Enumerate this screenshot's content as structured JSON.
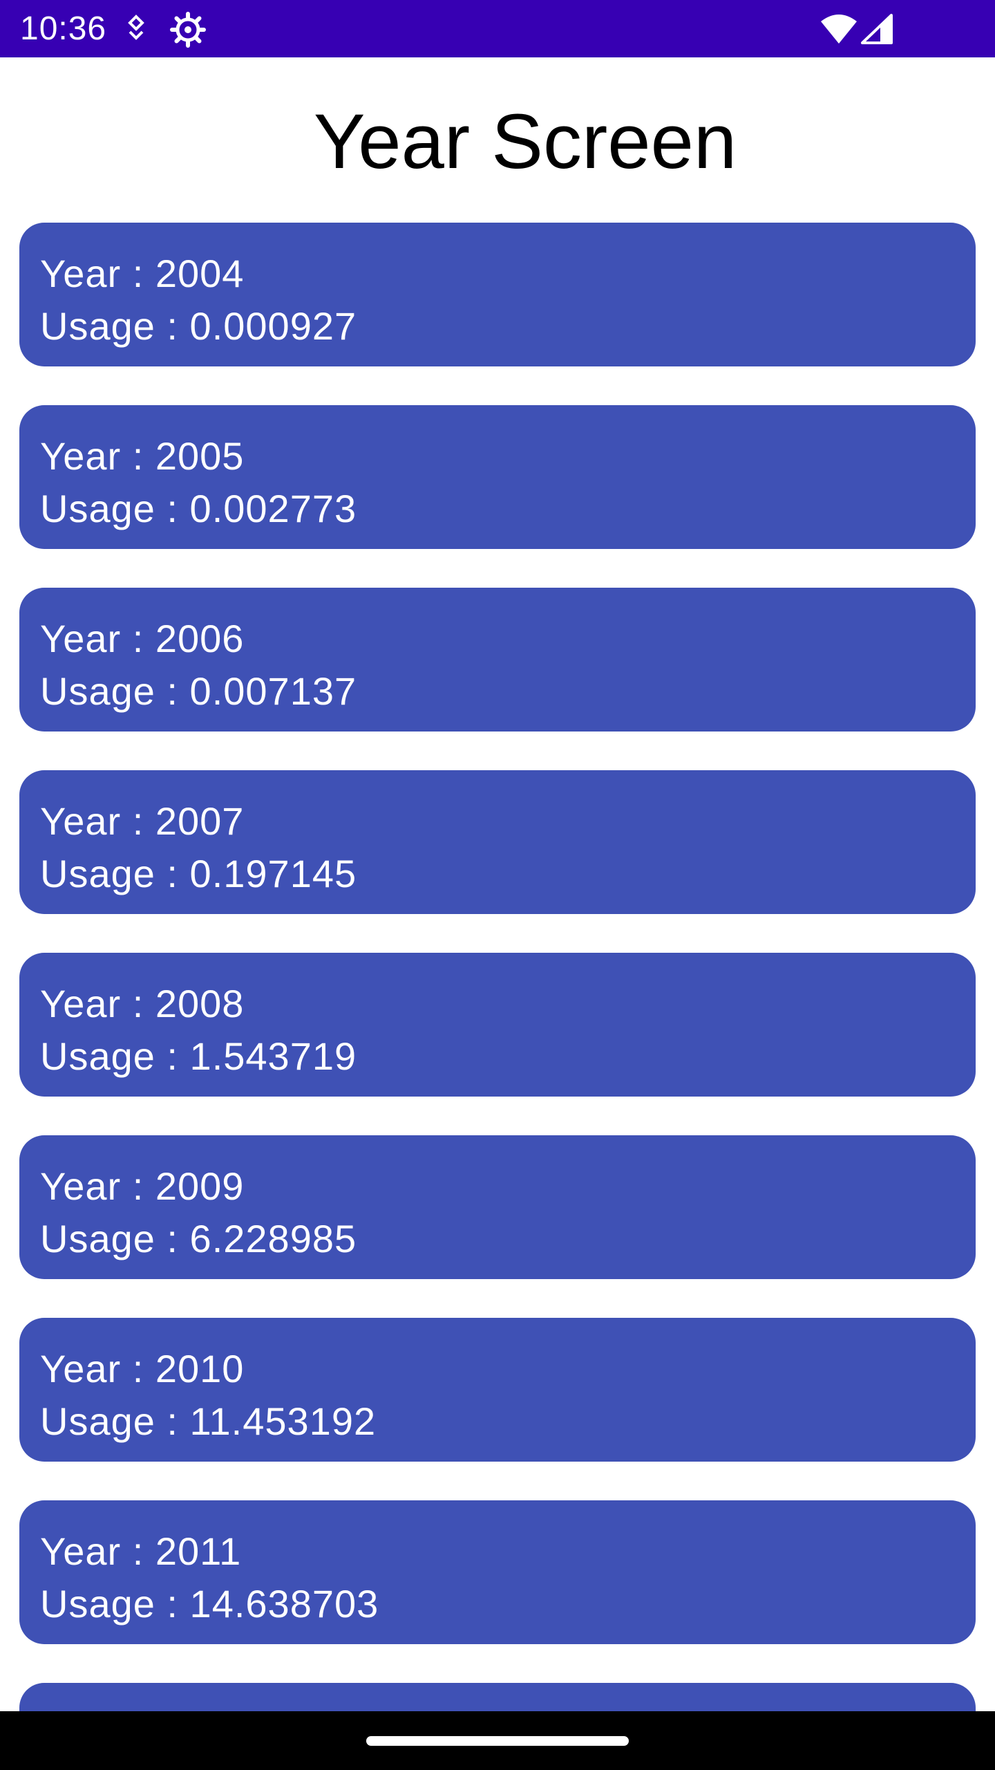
{
  "status_bar": {
    "time": "10:36",
    "icons_left": [
      "notification-icon",
      "settings-gear-icon"
    ],
    "icons_right": [
      "wifi-icon",
      "cell-signal-icon"
    ]
  },
  "screen": {
    "title": "Year Screen"
  },
  "items": [
    {
      "year": "Year : 2004",
      "usage": "Usage : 0.000927"
    },
    {
      "year": "Year : 2005",
      "usage": "Usage : 0.002773"
    },
    {
      "year": "Year : 2006",
      "usage": "Usage : 0.007137"
    },
    {
      "year": "Year : 2007",
      "usage": "Usage : 0.197145"
    },
    {
      "year": "Year : 2008",
      "usage": "Usage : 1.543719"
    },
    {
      "year": "Year : 2009",
      "usage": "Usage : 6.228985"
    },
    {
      "year": "Year : 2010",
      "usage": "Usage : 11.453192"
    },
    {
      "year": "Year : 2011",
      "usage": "Usage : 14.638703"
    },
    {
      "year": "",
      "usage": ""
    }
  ],
  "colors": {
    "status_bar": "#3700b3",
    "card": "#3f51b5",
    "card_text": "#ffffff",
    "background": "#ffffff"
  }
}
